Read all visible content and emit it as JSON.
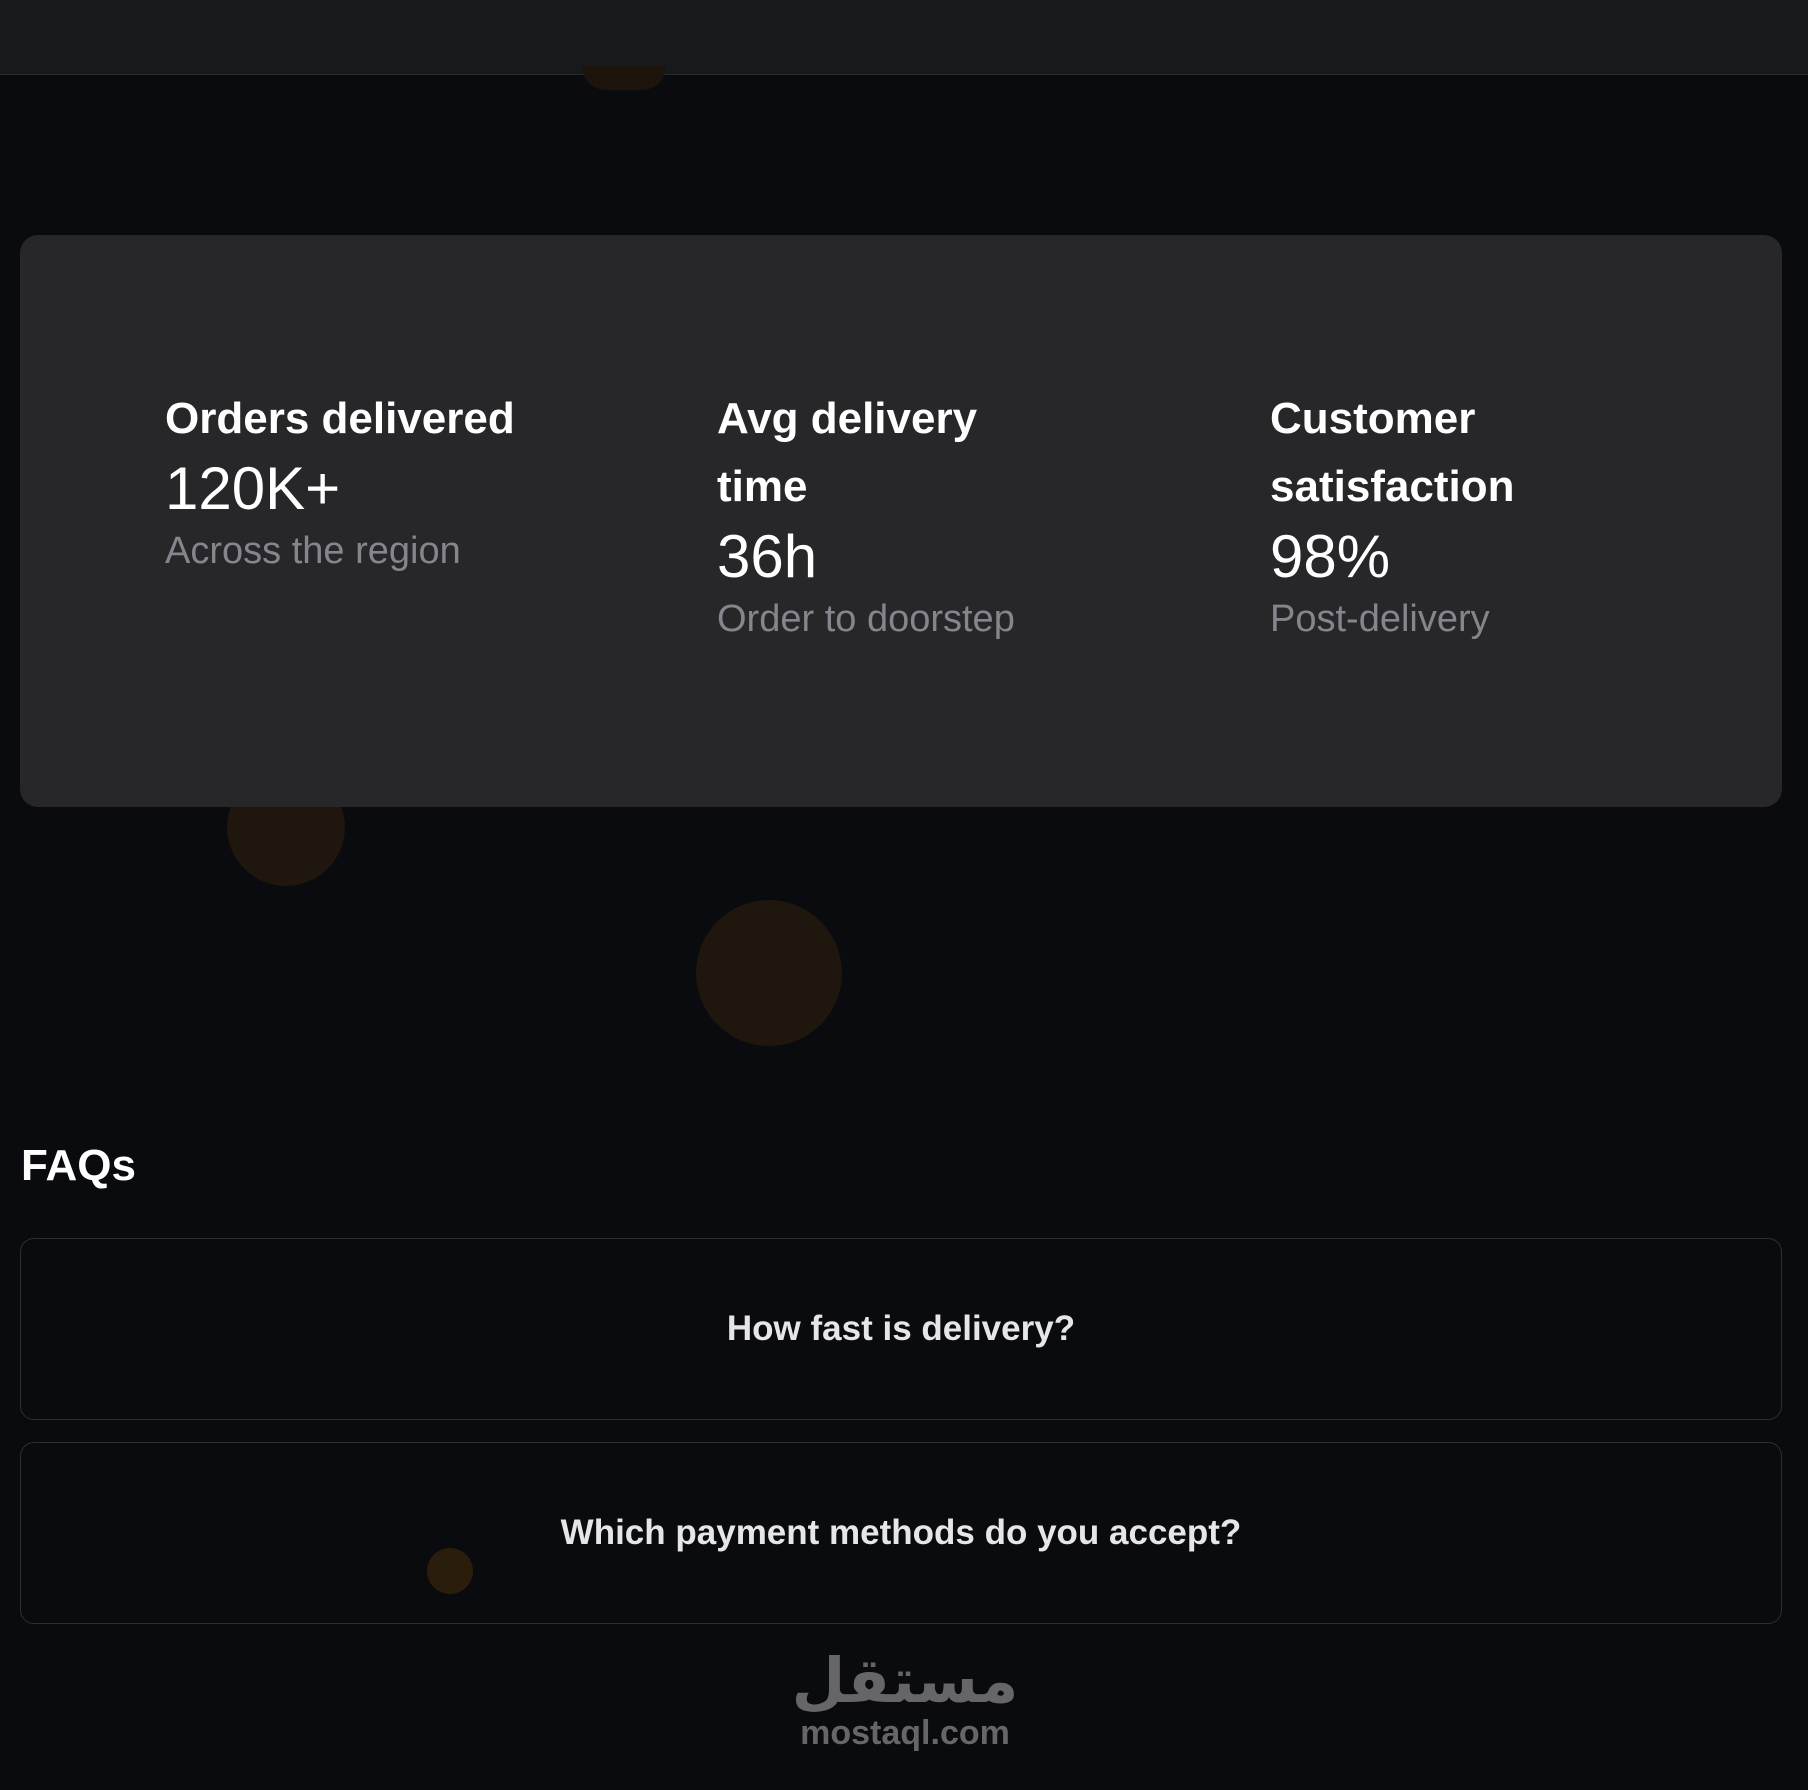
{
  "stats": [
    {
      "label": "Orders delivered",
      "value": "120K+",
      "caption": "Across the region"
    },
    {
      "label": "Avg delivery time",
      "value": "36h",
      "caption": "Order to doorstep"
    },
    {
      "label": "Customer satisfaction",
      "value": "98%",
      "caption": "Post-delivery"
    }
  ],
  "faq": {
    "title": "FAQs",
    "items": [
      {
        "question": "How fast is delivery?"
      },
      {
        "question": "Which payment methods do you accept?"
      }
    ]
  },
  "watermark": {
    "arabic": "مستقل",
    "latin": "mostaql.com"
  },
  "colors": {
    "background": "#0a0b0e",
    "card": "#27272a",
    "caption": "#85858d"
  }
}
